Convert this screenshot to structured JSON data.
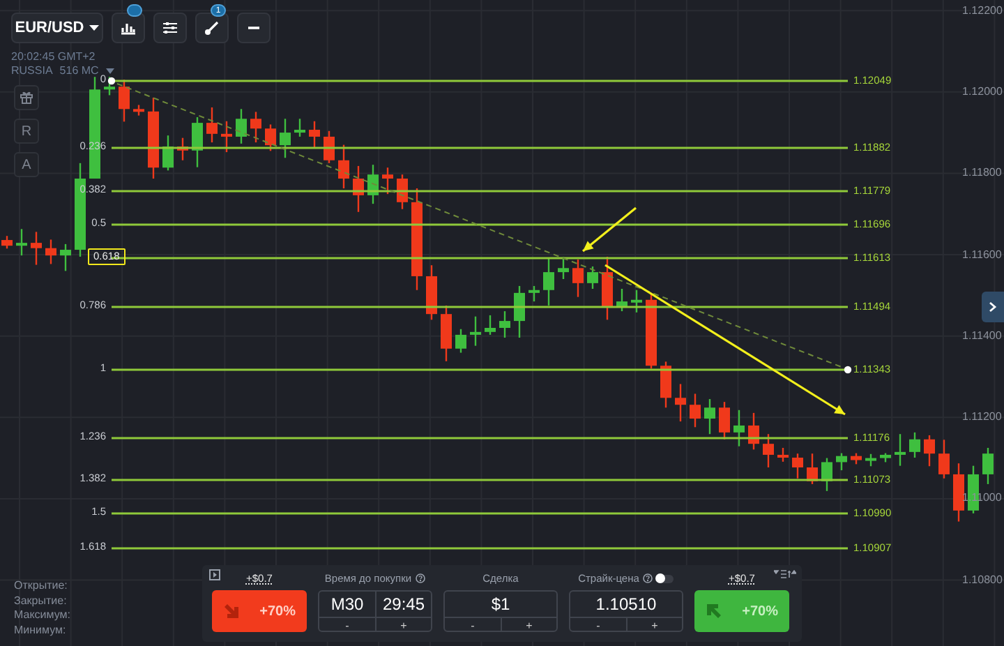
{
  "instrument": {
    "label": "EUR/USD"
  },
  "toolbar": [
    {
      "kind": "indicators",
      "badge": true
    },
    {
      "kind": "settings",
      "badge": false
    },
    {
      "kind": "drawing",
      "badge": true,
      "badge_text": "1"
    },
    {
      "kind": "more",
      "badge": false
    }
  ],
  "clock": "20:02:45 GMT+2",
  "region": {
    "name": "RUSSIA",
    "server": "516 MC"
  },
  "side_tools": [
    {
      "kind": "gift"
    },
    {
      "kind": "letter",
      "label": "R"
    },
    {
      "kind": "letter",
      "label": "A"
    }
  ],
  "fib_levels": [
    {
      "ratio": "0",
      "price": "1.12049",
      "highlighted": false
    },
    {
      "ratio": "0.236",
      "price": "1.11882",
      "highlighted": false
    },
    {
      "ratio": "0.382",
      "price": "1.11779",
      "highlighted": false
    },
    {
      "ratio": "0.5",
      "price": "1.11696",
      "highlighted": false
    },
    {
      "ratio": "0.618",
      "price": "1.11613",
      "highlighted": true
    },
    {
      "ratio": "0.786",
      "price": "1.11494",
      "highlighted": false
    },
    {
      "ratio": "1",
      "price": "1.11343",
      "highlighted": false
    },
    {
      "ratio": "1.236",
      "price": "1.11176",
      "highlighted": false
    },
    {
      "ratio": "1.382",
      "price": "1.11073",
      "highlighted": false
    },
    {
      "ratio": "1.5",
      "price": "1.10990",
      "highlighted": false
    },
    {
      "ratio": "1.618",
      "price": "1.10907",
      "highlighted": false
    }
  ],
  "chart_data": {
    "type": "candlestick",
    "grid": true,
    "ylim": [
      1.10638,
      1.12226
    ],
    "ohlc": [
      [
        1.11636,
        1.11646,
        1.11615,
        1.11622
      ],
      [
        1.11622,
        1.11663,
        1.11598,
        1.11629
      ],
      [
        1.11629,
        1.11656,
        1.11575,
        1.11616
      ],
      [
        1.11616,
        1.11637,
        1.11577,
        1.11598
      ],
      [
        1.11598,
        1.11626,
        1.1156,
        1.11612
      ],
      [
        1.11612,
        1.11825,
        1.11595,
        1.11787
      ],
      [
        1.11787,
        1.12037,
        1.11787,
        1.12006
      ],
      [
        1.12006,
        1.12037,
        1.11992,
        1.12013
      ],
      [
        1.12013,
        1.1203,
        1.11927,
        1.11958
      ],
      [
        1.11958,
        1.11968,
        1.11942,
        1.11952
      ],
      [
        1.11952,
        1.11986,
        1.11787,
        1.11814
      ],
      [
        1.11814,
        1.11893,
        1.11807,
        1.11866
      ],
      [
        1.11866,
        1.11887,
        1.11832,
        1.11856
      ],
      [
        1.11856,
        1.11938,
        1.11815,
        1.11924
      ],
      [
        1.11924,
        1.11962,
        1.11876,
        1.11897
      ],
      [
        1.11897,
        1.11928,
        1.11852,
        1.1189
      ],
      [
        1.1189,
        1.11958,
        1.11873,
        1.11934
      ],
      [
        1.11934,
        1.11951,
        1.11876,
        1.1191
      ],
      [
        1.1191,
        1.1192,
        1.11855,
        1.11869
      ],
      [
        1.11869,
        1.11934,
        1.11838,
        1.119
      ],
      [
        1.119,
        1.11934,
        1.1189,
        1.11907
      ],
      [
        1.11907,
        1.11928,
        1.11863,
        1.1189
      ],
      [
        1.1189,
        1.11904,
        1.11825,
        1.11832
      ],
      [
        1.11832,
        1.1187,
        1.11763,
        1.11787
      ],
      [
        1.11787,
        1.11818,
        1.11705,
        1.11746
      ],
      [
        1.11746,
        1.11821,
        1.11725,
        1.11797
      ],
      [
        1.11797,
        1.11814,
        1.11749,
        1.11787
      ],
      [
        1.11787,
        1.11797,
        1.11712,
        1.11729
      ],
      [
        1.11729,
        1.11763,
        1.11513,
        1.11547
      ],
      [
        1.11547,
        1.11574,
        1.1144,
        1.11454
      ],
      [
        1.11454,
        1.11475,
        1.11338,
        1.11369
      ],
      [
        1.11369,
        1.11417,
        1.11359,
        1.11403
      ],
      [
        1.11403,
        1.11448,
        1.11376,
        1.1141
      ],
      [
        1.1141,
        1.11451,
        1.11403,
        1.1142
      ],
      [
        1.1142,
        1.11461,
        1.11396,
        1.11437
      ],
      [
        1.11437,
        1.11523,
        1.11396,
        1.11506
      ],
      [
        1.11506,
        1.11523,
        1.11485,
        1.11513
      ],
      [
        1.11513,
        1.11591,
        1.11475,
        1.11557
      ],
      [
        1.11557,
        1.11594,
        1.1154,
        1.11567
      ],
      [
        1.11567,
        1.11588,
        1.11496,
        1.1153
      ],
      [
        1.1153,
        1.11571,
        1.11516,
        1.11557
      ],
      [
        1.11557,
        1.11595,
        1.1144,
        1.11471
      ],
      [
        1.11471,
        1.11516,
        1.11461,
        1.11485
      ],
      [
        1.11485,
        1.11513,
        1.11458,
        1.11489
      ],
      [
        1.11489,
        1.11506,
        1.1132,
        1.11327
      ],
      [
        1.11327,
        1.11337,
        1.11224,
        1.11248
      ],
      [
        1.11248,
        1.11282,
        1.1119,
        1.11231
      ],
      [
        1.11231,
        1.11258,
        1.11176,
        1.11197
      ],
      [
        1.11197,
        1.11245,
        1.11159,
        1.11224
      ],
      [
        1.11224,
        1.11238,
        1.11146,
        1.11163
      ],
      [
        1.11163,
        1.11218,
        1.11129,
        1.1118
      ],
      [
        1.1118,
        1.11211,
        1.11121,
        1.11135
      ],
      [
        1.11135,
        1.11159,
        1.11077,
        1.11108
      ],
      [
        1.11108,
        1.11125,
        1.11091,
        1.11101
      ],
      [
        1.11101,
        1.11111,
        1.1105,
        1.11077
      ],
      [
        1.11077,
        1.11111,
        1.11036,
        1.11043
      ],
      [
        1.11043,
        1.111,
        1.11019,
        1.1109
      ],
      [
        1.1109,
        1.11112,
        1.1107,
        1.11105
      ],
      [
        1.11105,
        1.11112,
        1.11085,
        1.11095
      ],
      [
        1.11095,
        1.1111,
        1.1108,
        1.111
      ],
      [
        1.111,
        1.11112,
        1.1109,
        1.11108
      ],
      [
        1.11108,
        1.11159,
        1.11081,
        1.11115
      ],
      [
        1.11115,
        1.11163,
        1.11101,
        1.11146
      ],
      [
        1.11146,
        1.11156,
        1.1108,
        1.11111
      ],
      [
        1.11111,
        1.11145,
        1.1105,
        1.1106
      ],
      [
        1.1106,
        1.11087,
        1.10944,
        1.10971
      ],
      [
        1.10971,
        1.11081,
        1.10964,
        1.1106
      ],
      [
        1.1106,
        1.11125,
        1.11036,
        1.11111
      ]
    ],
    "yticks": [
      {
        "value": 1.122,
        "label": "1.12200"
      },
      {
        "value": 1.12,
        "label": "1.12000"
      },
      {
        "value": 1.118,
        "label": "1.11800"
      },
      {
        "value": 1.116,
        "label": "1.11600"
      },
      {
        "value": 1.114,
        "label": "1.11400"
      },
      {
        "value": 1.112,
        "label": "1.11200"
      },
      {
        "value": 1.11,
        "label": "1.11000"
      },
      {
        "value": 1.108,
        "label": "1.10800"
      }
    ]
  },
  "ohlc_labels": [
    "Открытие:",
    "Закрытие:",
    "Максимум:",
    "Минимум:"
  ],
  "trade_panel": {
    "put": {
      "payout": "+$0.7",
      "percent": "+70%"
    },
    "timer": {
      "label": "Время до покупки",
      "timeframe": "M30",
      "time": "29:45",
      "minus": "-",
      "plus": "+"
    },
    "amount": {
      "label": "Сделка",
      "value": "$1",
      "minus": "-",
      "plus": "+"
    },
    "strike": {
      "label": "Страйк-цена",
      "value": "1.10510",
      "minus": "-",
      "plus": "+",
      "toggle_on": false
    },
    "call": {
      "payout": "+$0.7",
      "percent": "+70%"
    }
  }
}
